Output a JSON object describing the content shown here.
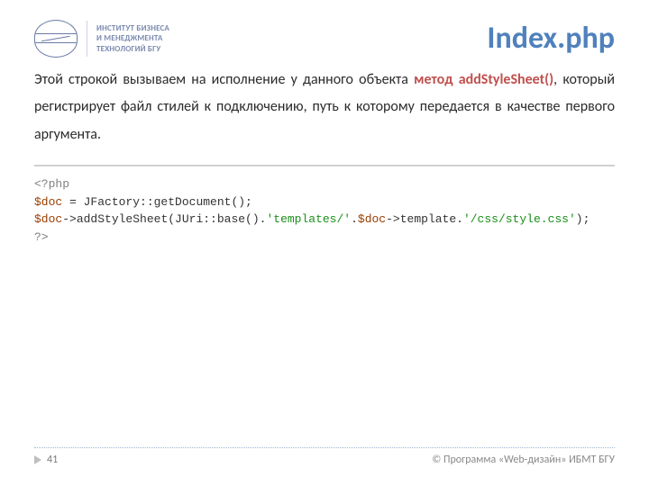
{
  "header": {
    "title": "Index.php",
    "org_line1": "ИНСТИТУТ БИЗНЕСА",
    "org_line2": "И МЕНЕДЖМЕНТА",
    "org_line3": "ТЕХНОЛОГИЙ БГУ"
  },
  "body": {
    "lead": "Этой строкой вызываем на исполнение у данного объекта ",
    "kw": "метод addStyleSheet()",
    "tail": ", который регистрирует файл стилей к подключению, путь к которому передается в качестве первого аргумента."
  },
  "code": {
    "open": "<?php",
    "l1_var": "$doc",
    "l1_rest": " = JFactory::getDocument();",
    "l2_var": "$doc",
    "l2_arrow": "->",
    "l2_call": "addStyleSheet(JUri::base().",
    "l2_str1": "'templates/'",
    "l2_dot": ".",
    "l2_var2": "$doc",
    "l2_arrow2": "->",
    "l2_tmpl": "template.",
    "l2_str2": "'/css/style.css'",
    "l2_close": ");",
    "close": "?>"
  },
  "footer": {
    "page": "41",
    "copyright": "© Программа «Web-дизайн» ИБМТ БГУ"
  }
}
